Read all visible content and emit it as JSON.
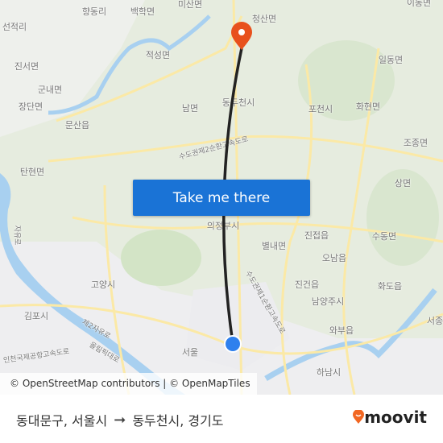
{
  "map": {
    "labels": {
      "hyangdong": "향동리",
      "baekhak": "백학면",
      "misan": "미산면",
      "cheongsan": "청산면",
      "idong": "이동면",
      "seonjeok": "선적리",
      "jinseo": "진서면",
      "gunnae": "군내면",
      "jangdan": "장단면",
      "munsan": "문산읍",
      "jeokseong": "적성면",
      "nam": "남면",
      "dongducheon": "동두천시",
      "pocheon": "포천시",
      "ildong": "일동면",
      "hwahyeon": "화현면",
      "jojong": "조종면",
      "sang": "상면",
      "tanhyeon": "탄현면",
      "uijeongbu": "의정부시",
      "byeollae": "별내면",
      "jinjeop": "진접읍",
      "sudong": "수동면",
      "onam": "오남읍",
      "jingeon": "진건읍",
      "hwado": "화도읍",
      "namyangju": "남양주시",
      "goyang": "고양시",
      "gimpo": "김포시",
      "wabu": "와부읍",
      "seoul": "서울",
      "hanam": "하남시",
      "seojong": "서종",
      "road_ring": "수도권제2순환고속도로",
      "road_jayu": "자유로",
      "road_je2jayu": "제2자유로",
      "road_olympic": "올림픽대로",
      "road_incheon": "인천국제공항고속도로",
      "road_seoul_ring": "수도권제1순환고속도로"
    },
    "cta_label": "Take me there",
    "attribution": "© OpenStreetMap contributors | © OpenMapTiles",
    "origin_color": "#2f80ed",
    "destination_color": "#e8501c",
    "route_color": "#222222"
  },
  "footer": {
    "origin": "동대문구, 서울시",
    "arrow_icon": "arrow-right-icon",
    "destination": "동두천시, 경기도",
    "brand": "moovit",
    "brand_color": "#f26722"
  }
}
